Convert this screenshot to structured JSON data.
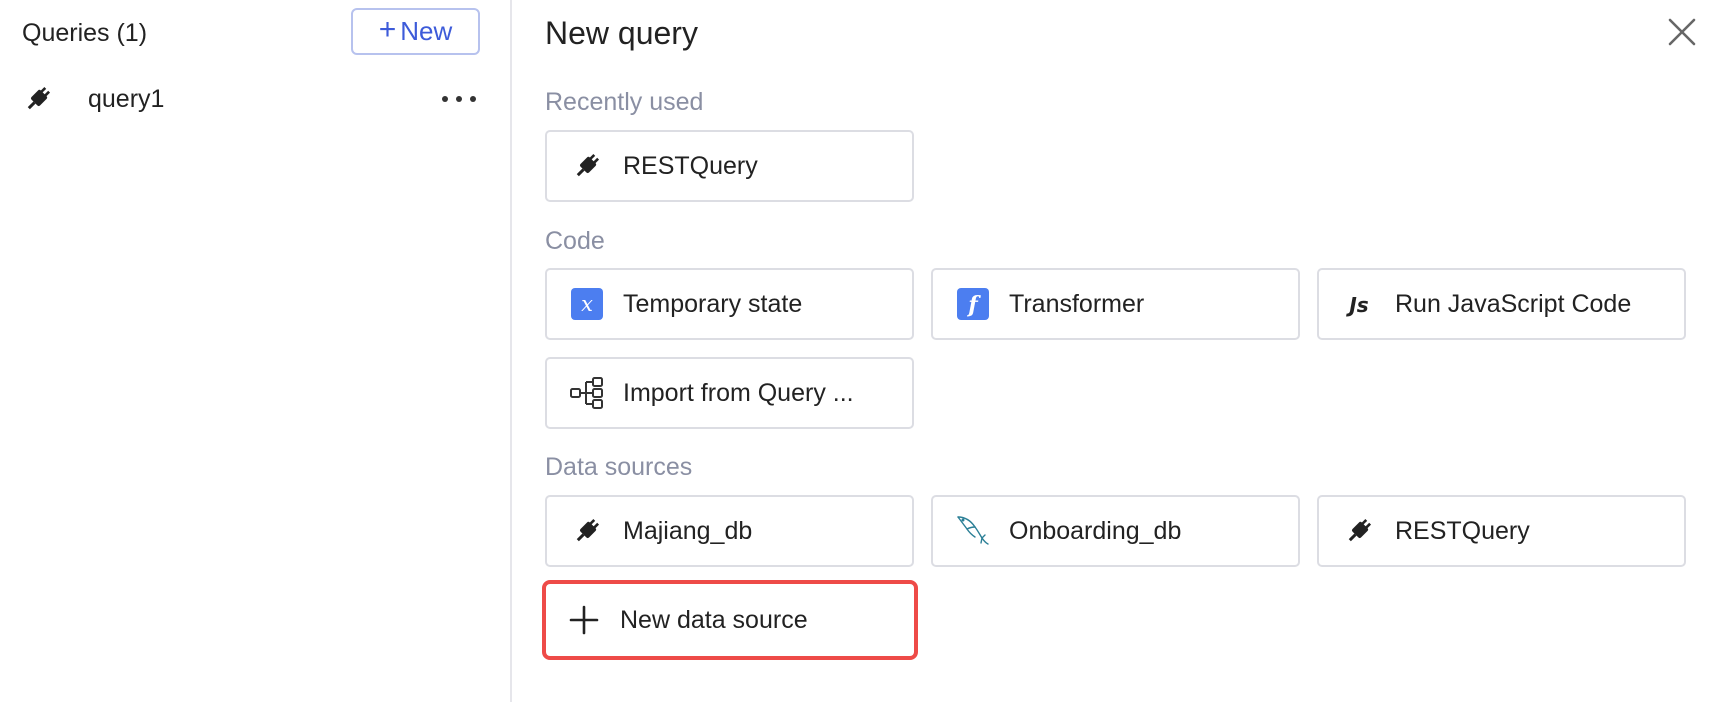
{
  "left": {
    "title": "Queries (1)",
    "new_button": {
      "plus": "+",
      "label": "New"
    },
    "queries": [
      {
        "name": "query1",
        "icon": "plug-icon"
      }
    ]
  },
  "right": {
    "title": "New query",
    "sections": {
      "recent": {
        "label": "Recently used",
        "tiles": [
          {
            "label": "RESTQuery",
            "icon": "plug-icon"
          }
        ]
      },
      "code": {
        "label": "Code",
        "tiles": [
          {
            "label": "Temporary state",
            "icon": "temporary-state-icon"
          },
          {
            "label": "Transformer",
            "icon": "transformer-icon"
          },
          {
            "label": "Run JavaScript Code",
            "icon": "javascript-icon"
          },
          {
            "label": "Import from Query ...",
            "icon": "query-library-icon"
          }
        ]
      },
      "data_sources": {
        "label": "Data sources",
        "tiles": [
          {
            "label": "Majiang_db",
            "icon": "plug-icon"
          },
          {
            "label": "Onboarding_db",
            "icon": "mysql-dolphin-icon"
          },
          {
            "label": "RESTQuery",
            "icon": "plug-icon"
          },
          {
            "label": "New data source",
            "icon": "plus-icon"
          }
        ]
      }
    }
  },
  "colors": {
    "accent": "#3d5bd9",
    "icon_blue": "#4c7ef0",
    "highlight": "#ee4b48",
    "section_label": "#8a8fa3",
    "border": "#dcdde3"
  }
}
